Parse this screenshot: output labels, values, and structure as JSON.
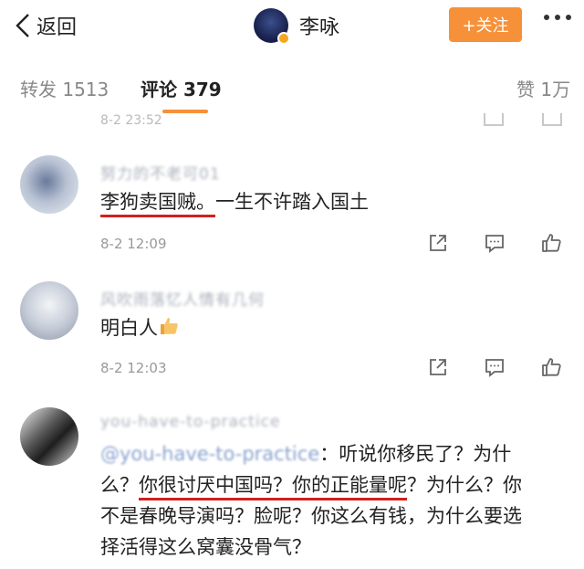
{
  "header": {
    "back_label": "返回",
    "profile_name": "李咏",
    "follow_label": "+关注"
  },
  "tabs": {
    "repost": "转发 1513",
    "comments": "评论 379",
    "likes": "赞 1万"
  },
  "faded_row": {
    "time": "8-2 23:52"
  },
  "comments": [
    {
      "username": "努力的不老可01",
      "text_highlight": "李狗卖国贼。",
      "text_rest": "一生不许踏入国土",
      "time": "8-2 12:09"
    },
    {
      "username": "风吹雨落忆人情有几何",
      "text": "明白人",
      "time": "8-2 12:03"
    },
    {
      "username": "you-have-to-practice",
      "mention": "@you-have-to-practice",
      "line1_rest": "：听说你移民了？为什",
      "line2_a": "么？",
      "line2_highlight": "你很讨厌中国吗？你的正能量呢",
      "line2_b": "？为什么？你",
      "line3": "不是春晚导演吗？脸呢？你这么有钱，为什么要选",
      "line4": "择活得这么窝囊没骨气？"
    }
  ],
  "colors": {
    "accent": "#f6913a",
    "highlight_underline": "#d21f1f"
  }
}
